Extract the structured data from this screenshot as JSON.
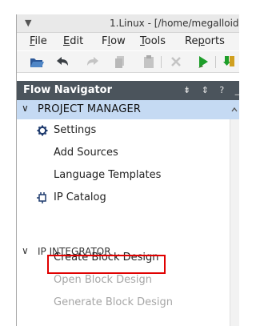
{
  "window": {
    "title": "1.Linux - [/home/megalloid"
  },
  "menu": [
    {
      "label": "File",
      "mnemonic": "F",
      "rest": "ile"
    },
    {
      "label": "Edit",
      "mnemonic": "E",
      "rest": "dit"
    },
    {
      "label": "Flow",
      "mnemonic": "l",
      "pre": "F",
      "rest": "ow"
    },
    {
      "label": "Tools",
      "mnemonic": "T",
      "rest": "ools"
    },
    {
      "label": "Reports",
      "mnemonic": "p",
      "pre": "Re",
      "rest": "orts"
    }
  ],
  "flow_navigator": {
    "title": "Flow Navigator",
    "header_icons": "⇟ ⇕ ? _",
    "project_manager": {
      "label": "PROJECT MANAGER",
      "items": [
        "Settings",
        "Add Sources",
        "Language Templates",
        "IP Catalog"
      ]
    },
    "ip_integrator": {
      "label": "IP INTEGRATOR",
      "items": [
        "Create Block Design",
        "Open Block Design",
        "Generate Block Design"
      ]
    }
  },
  "colors": {
    "nav_header_bg": "#4b545c",
    "section_highlight": "#c5daf3",
    "annotation_box": "#e00000",
    "disabled_text": "#a6a6a6"
  }
}
